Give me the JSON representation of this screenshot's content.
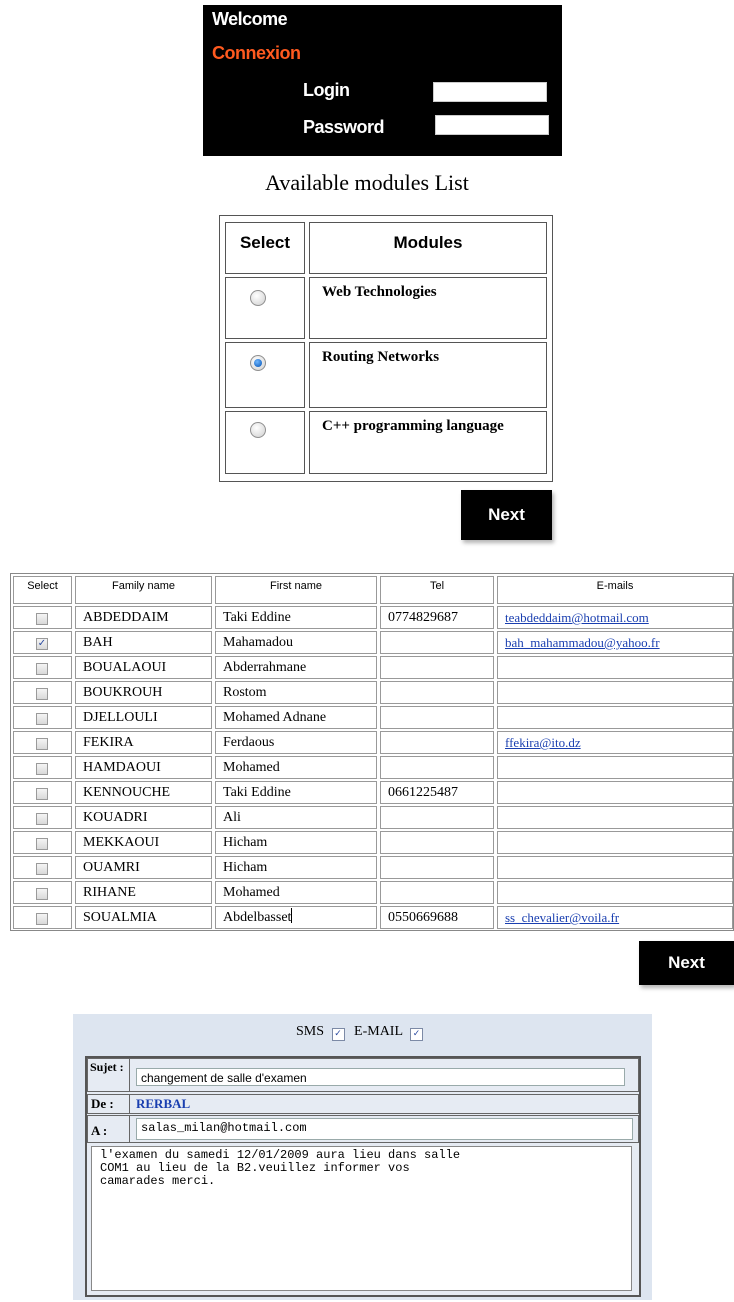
{
  "login": {
    "welcome": "Welcome",
    "connexion": "Connexion",
    "login_label": "Login",
    "password_label": "Password"
  },
  "modules": {
    "title": "Available modules List",
    "headers": [
      "Select",
      "Modules"
    ],
    "rows": [
      {
        "name": "Web Technologies",
        "selected": false
      },
      {
        "name": "Routing Networks",
        "selected": true
      },
      {
        "name": "C++ programming language",
        "selected": false
      }
    ],
    "next_label": "Next"
  },
  "students": {
    "headers": [
      "Select",
      "Family name",
      "First name",
      "Tel",
      "E-mails"
    ],
    "rows": [
      {
        "checked": false,
        "family": "ABDEDDAIM",
        "first": "Taki Eddine",
        "tel": "0774829687",
        "email": "teabdeddaim@hotmail.com"
      },
      {
        "checked": true,
        "family": "BAH",
        "first": "Mahamadou",
        "tel": "",
        "email": "bah_mahammadou@yahoo.fr"
      },
      {
        "checked": false,
        "family": "BOUALAOUI",
        "first": "Abderrahmane",
        "tel": "",
        "email": ""
      },
      {
        "checked": false,
        "family": "BOUKROUH",
        "first": "Rostom",
        "tel": "",
        "email": ""
      },
      {
        "checked": false,
        "family": "DJELLOULI",
        "first": "Mohamed Adnane",
        "tel": "",
        "email": ""
      },
      {
        "checked": false,
        "family": "FEKIRA",
        "first": "Ferdaous",
        "tel": "",
        "email": "ffekira@ito.dz"
      },
      {
        "checked": false,
        "family": "HAMDAOUI",
        "first": "Mohamed",
        "tel": "",
        "email": ""
      },
      {
        "checked": false,
        "family": "KENNOUCHE",
        "first": "Taki Eddine",
        "tel": "0661225487",
        "email": ""
      },
      {
        "checked": false,
        "family": "KOUADRI",
        "first": "Ali",
        "tel": "",
        "email": ""
      },
      {
        "checked": false,
        "family": "MEKKAOUI",
        "first": "Hicham",
        "tel": "",
        "email": ""
      },
      {
        "checked": false,
        "family": "OUAMRI",
        "first": "Hicham",
        "tel": "",
        "email": ""
      },
      {
        "checked": false,
        "family": "RIHANE",
        "first": "Mohamed",
        "tel": "",
        "email": ""
      },
      {
        "checked": false,
        "family": "SOUALMIA",
        "first": "Abdelbasset",
        "tel": "0550669688",
        "email": "ss_chevalier@voila.fr"
      }
    ],
    "next_label": "Next"
  },
  "message": {
    "sms_label": "SMS",
    "sms_checked": true,
    "email_label": "E-MAIL",
    "email_checked": true,
    "subject_label": "Sujet :",
    "subject_value": "changement de salle d'examen",
    "from_label": "De :",
    "from_value": "RERBAL",
    "to_label": "A :",
    "to_value": "salas_milan@hotmail.com",
    "body": "l'examen du samedi 12/01/2009 aura lieu dans salle\nCOM1 au lieu de la B2.veuillez informer vos\ncamarades merci."
  },
  "colors": {
    "login_bg": "#000000",
    "connexion_accent": "#ff5a1f",
    "link": "#1a3fb0",
    "panel_bg": "#dde5f0"
  }
}
